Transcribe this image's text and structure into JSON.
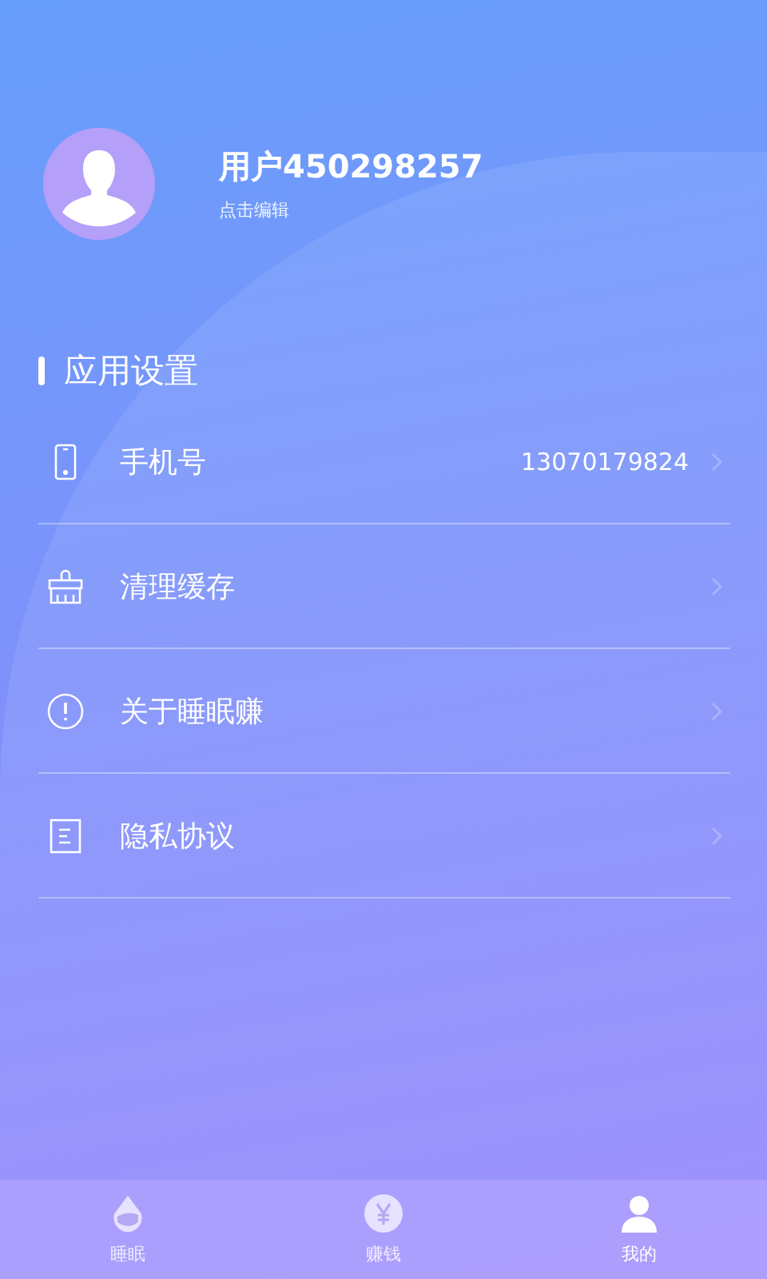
{
  "profile": {
    "name": "用户450298257",
    "subtitle": "点击编辑"
  },
  "section": {
    "title": "应用设置"
  },
  "rows": [
    {
      "kind": "phone",
      "label": "手机号",
      "value": "13070179824"
    },
    {
      "kind": "broom",
      "label": "清理缓存"
    },
    {
      "kind": "info",
      "label": "关于睡眠赚"
    },
    {
      "kind": "document",
      "label": "隐私协议"
    }
  ],
  "nav": [
    {
      "kind": "drop",
      "label": "睡眠",
      "selected": false
    },
    {
      "kind": "yen",
      "label": "赚钱",
      "selected": false
    },
    {
      "kind": "person",
      "label": "我的",
      "selected": true
    }
  ]
}
